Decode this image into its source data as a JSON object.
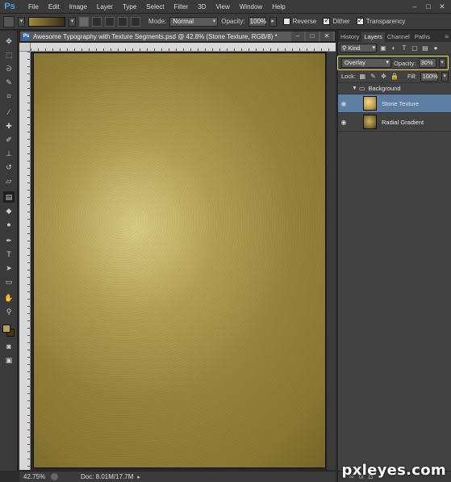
{
  "app": {
    "logo": "Ps",
    "menu": [
      "File",
      "Edit",
      "Image",
      "Layer",
      "Type",
      "Select",
      "Filter",
      "3D",
      "View",
      "Window",
      "Help"
    ],
    "window_buttons": [
      "–",
      "□",
      "✕"
    ]
  },
  "options_bar": {
    "mode_label": "Mode:",
    "mode_value": "Normal",
    "opacity_label": "Opacity:",
    "opacity_value": "100%",
    "reverse_label": "Reverse",
    "reverse_checked": false,
    "dither_label": "Dither",
    "dither_checked": true,
    "transparency_label": "Transparency",
    "transparency_checked": true,
    "gradient_colors": [
      "#a08a3c",
      "#3a2f12"
    ]
  },
  "toolbar": {
    "tools": [
      {
        "name": "move-tool-icon",
        "glyph": "✥"
      },
      {
        "name": "marquee-tool-icon",
        "glyph": "⬚"
      },
      {
        "name": "lasso-tool-icon",
        "glyph": "ᘐ"
      },
      {
        "name": "quick-select-tool-icon",
        "glyph": "✎"
      },
      {
        "name": "crop-tool-icon",
        "glyph": "⌗"
      },
      {
        "name": "eyedropper-tool-icon",
        "glyph": "⁄"
      },
      {
        "name": "healing-brush-tool-icon",
        "glyph": "✚"
      },
      {
        "name": "brush-tool-icon",
        "glyph": "✐"
      },
      {
        "name": "clone-stamp-tool-icon",
        "glyph": "⊥"
      },
      {
        "name": "history-brush-tool-icon",
        "glyph": "↺"
      },
      {
        "name": "eraser-tool-icon",
        "glyph": "▱"
      },
      {
        "name": "gradient-tool-icon",
        "glyph": "▤"
      },
      {
        "name": "blur-tool-icon",
        "glyph": "◆"
      },
      {
        "name": "dodge-tool-icon",
        "glyph": "●"
      },
      {
        "name": "pen-tool-icon",
        "glyph": "✒"
      },
      {
        "name": "type-tool-icon",
        "glyph": "T"
      },
      {
        "name": "path-select-tool-icon",
        "glyph": "➤"
      },
      {
        "name": "shape-tool-icon",
        "glyph": "▭"
      },
      {
        "name": "hand-tool-icon",
        "glyph": "✋"
      },
      {
        "name": "zoom-tool-icon",
        "glyph": "⚲"
      }
    ],
    "selected_tool": "gradient-tool-icon",
    "foreground_color": "#b9a15a",
    "background_color": "#4b3410",
    "quick_mask_glyph": "◙",
    "screen_mode_glyph": "▣"
  },
  "document": {
    "tab_title": "Awesome Typography with Texture Segments.psd @ 42.8% (Stone Texture, RGB/8) *",
    "zoom": "42.75%",
    "doc_size": "Doc: 8.01M/17.7M",
    "status_arrow": "▸",
    "window_buttons": [
      "–",
      "□",
      "✕"
    ]
  },
  "layers_panel": {
    "tabs": [
      "History",
      "Layers",
      "Channel",
      "Paths"
    ],
    "active_tab": "Layers",
    "panel_menu": "≡",
    "kind_label": "Kind",
    "blend_mode": "Overlay",
    "opacity_label": "Opacity:",
    "opacity_value": "30%",
    "lock_label": "Lock:",
    "fill_label": "Fill:",
    "fill_value": "100%",
    "group": {
      "name": "Background",
      "expanded": true
    },
    "layers": [
      {
        "name": "Stone Texture",
        "selected": true,
        "visible": true
      },
      {
        "name": "Radial Gradient",
        "selected": false,
        "visible": true
      }
    ]
  },
  "watermark": "pxleyes.com"
}
